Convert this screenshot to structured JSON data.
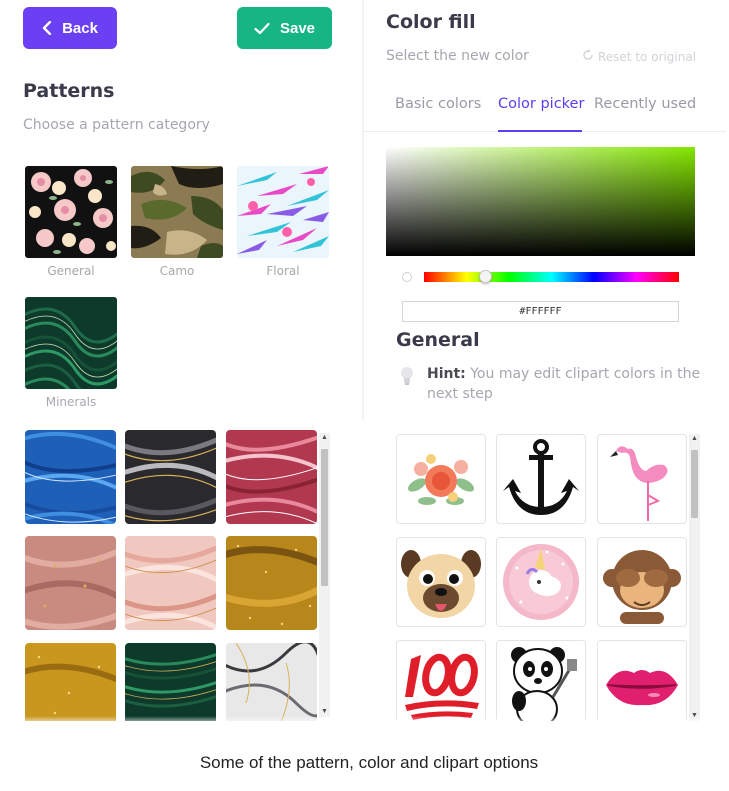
{
  "toolbar": {
    "back_label": "Back",
    "save_label": "Save"
  },
  "patterns": {
    "title": "Patterns",
    "subtitle": "Choose a pattern category",
    "categories": [
      {
        "label": "General"
      },
      {
        "label": "Camo"
      },
      {
        "label": "Floral"
      },
      {
        "label": "Minerals"
      }
    ]
  },
  "color_fill": {
    "title": "Color fill",
    "subtitle": "Select the new color",
    "reset_label": "Reset to original",
    "tabs": [
      "Basic colors",
      "Color picker",
      "Recently used"
    ],
    "active_tab": "Color picker",
    "hex_value": "#FFFFFF",
    "base_hue_color": "#84e600"
  },
  "clipart": {
    "title": "General",
    "hint_label": "Hint:",
    "hint_text": "You may edit clipart colors in the next step"
  },
  "caption": "Some of the pattern, color and clipart options",
  "colors": {
    "accent_purple": "#6b3ff2",
    "save_green": "#17b584"
  }
}
